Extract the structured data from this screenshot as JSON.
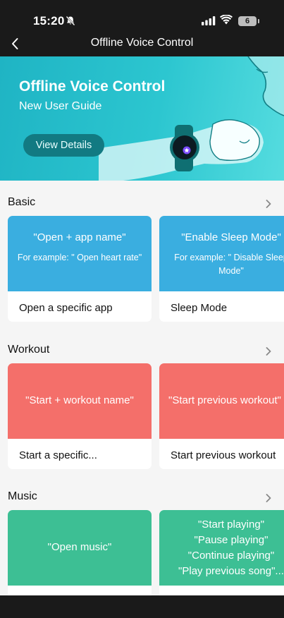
{
  "status_bar": {
    "time": "15:20",
    "battery": "6"
  },
  "nav": {
    "title": "Offline Voice Control"
  },
  "hero": {
    "title": "Offline Voice Control",
    "subtitle": "New User Guide",
    "button": "View Details"
  },
  "sections": [
    {
      "title": "Basic",
      "cards": [
        {
          "command": "\"Open + app name\"",
          "example": "For example: \" Open heart rate\"",
          "label": "Open a specific app",
          "color": "#3aaee0"
        },
        {
          "command": "\"Enable Sleep Mode\"",
          "example": "For example: \" Disable Sleep Mode\"",
          "label": "Sleep Mode",
          "color": "#3aaee0"
        }
      ]
    },
    {
      "title": "Workout",
      "cards": [
        {
          "command": "\"Start + workout name\"",
          "label": "Start a specific...",
          "color": "#f46f6a"
        },
        {
          "command": "\"Start previous workout\"",
          "label": "Start previous workout",
          "color": "#f46f6a"
        }
      ]
    },
    {
      "title": "Music",
      "cards": [
        {
          "command": "\"Open music\"",
          "color": "#3dbf94"
        },
        {
          "lines": [
            "\"Start playing\"",
            "\"Pause playing\"",
            "\"Continue playing\"",
            "\"Play previous song\"..."
          ],
          "color": "#3dbf94"
        }
      ]
    }
  ]
}
